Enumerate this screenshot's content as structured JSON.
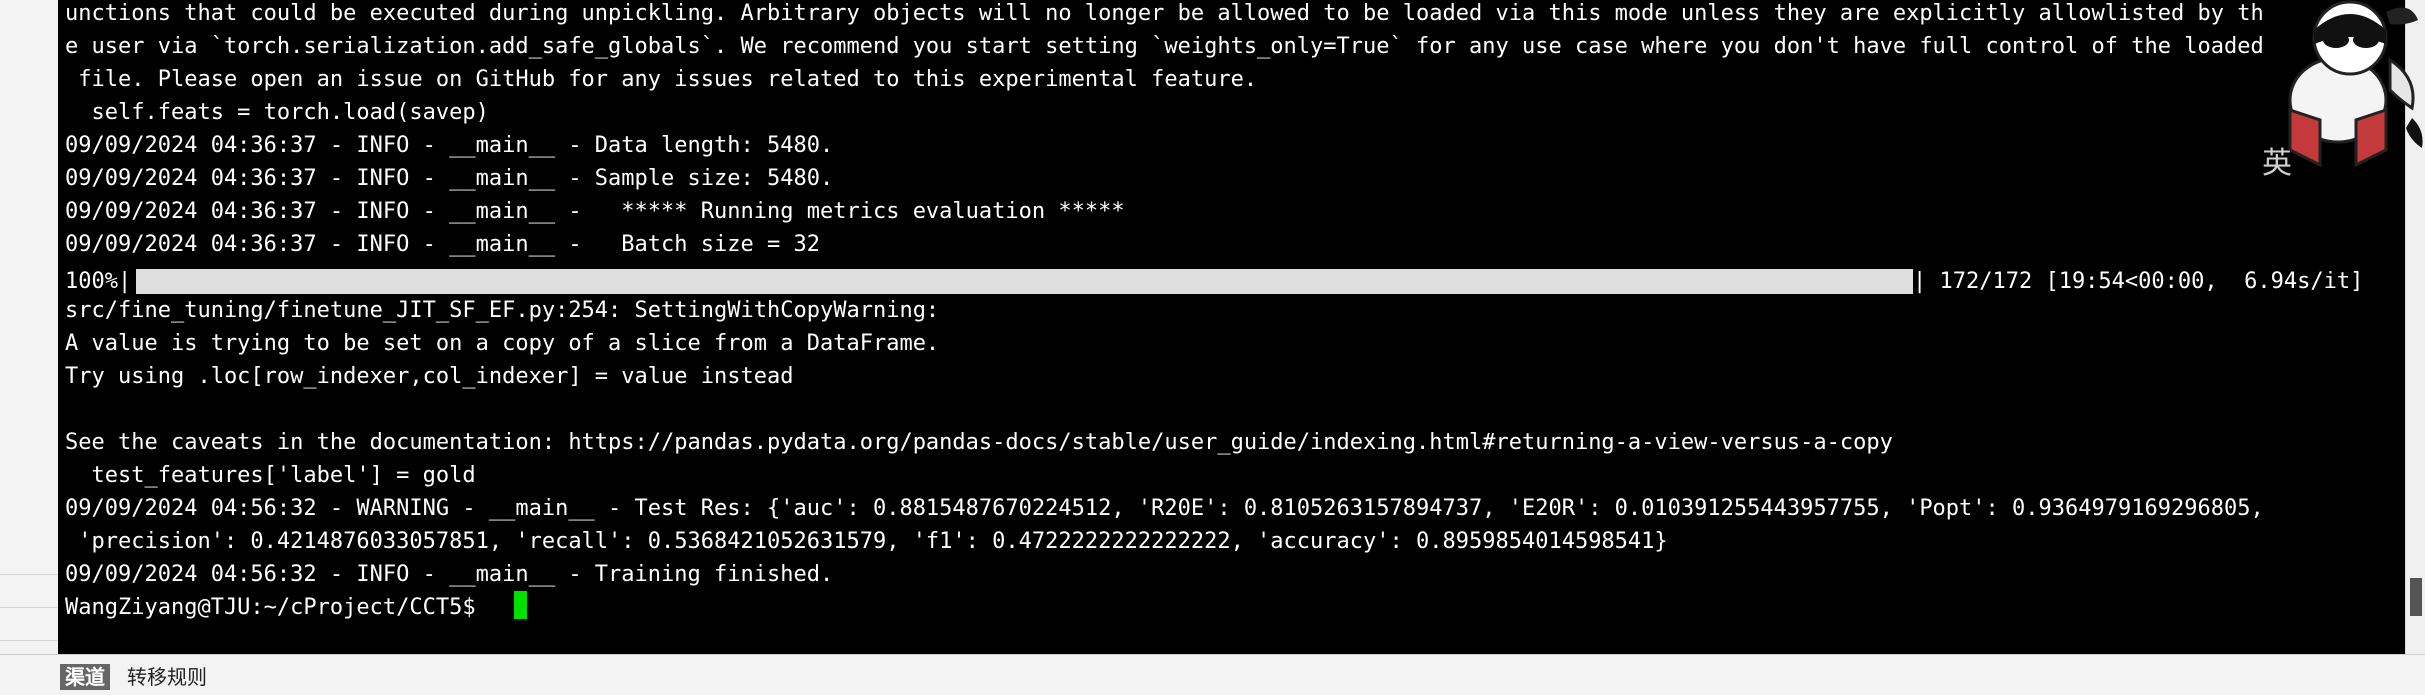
{
  "terminal": {
    "lines": [
      "unctions that could be executed during unpickling. Arbitrary objects will no longer be allowed to be loaded via this mode unless they are explicitly allowlisted by th",
      "e user via `torch.serialization.add_safe_globals`. We recommend you start setting `weights_only=True` for any use case where you don't have full control of the loaded",
      " file. Please open an issue on GitHub for any issues related to this experimental feature.",
      "  self.feats = torch.load(savep)",
      "09/09/2024 04:36:37 - INFO - __main__ - Data length: 5480.",
      "09/09/2024 04:36:37 - INFO - __main__ - Sample size: 5480.",
      "09/09/2024 04:36:37 - INFO - __main__ -   ***** Running metrics evaluation *****",
      "09/09/2024 04:36:37 - INFO - __main__ -   Batch size = 32",
      "src/fine_tuning/finetune_JIT_SF_EF.py:254: SettingWithCopyWarning:",
      "A value is trying to be set on a copy of a slice from a DataFrame.",
      "Try using .loc[row_indexer,col_indexer] = value instead",
      "",
      "See the caveats in the documentation: https://pandas.pydata.org/pandas-docs/stable/user_guide/indexing.html#returning-a-view-versus-a-copy",
      "  test_features['label'] = gold",
      "09/09/2024 04:56:32 - WARNING - __main__ - Test Res: {'auc': 0.8815487670224512, 'R20E': 0.8105263157894737, 'E20R': 0.010391255443957755, 'Popt': 0.9364979169296805,",
      " 'precision': 0.4214876033057851, 'recall': 0.5368421052631579, 'f1': 0.4722222222222222, 'accuracy': 0.8959854014598541}",
      "09/09/2024 04:56:32 - INFO - __main__ - Training finished."
    ],
    "progress": {
      "percent_label": "100%|",
      "fraction": 1.0,
      "stats": "| 172/172 [19:54<00:00,  6.94s/it]"
    },
    "prompt": "WangZiyang@TJU:~/cProject/CCT5$ "
  },
  "bottom_bar": {
    "channel_tag": "渠道",
    "transfer_rules": "转移规则"
  },
  "overlay": {
    "ime_char": "英"
  },
  "colors": {
    "terminal_bg": "#000000",
    "terminal_fg": "#ffffff",
    "cursor": "#00e000",
    "progress_fill": "#dedede"
  },
  "icons": {
    "mascot": "cartoon-mascot-icon"
  }
}
